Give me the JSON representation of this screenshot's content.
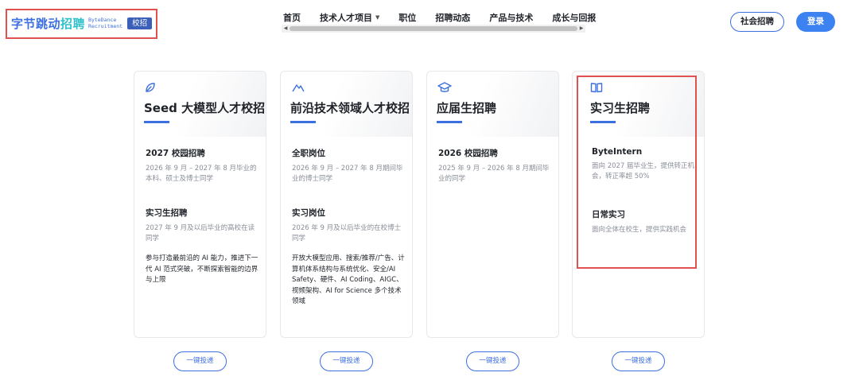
{
  "logo": {
    "cn_part1": "字节跳动",
    "cn_part2": "招聘",
    "en_line1": "ByteDance",
    "en_line2": "Recruitment",
    "badge": "校招"
  },
  "nav": {
    "items": [
      "首页",
      "技术人才项目",
      "职位",
      "招聘动态",
      "产品与技术",
      "成长与回报"
    ]
  },
  "header": {
    "social_label": "社会招聘",
    "login_label": "登录"
  },
  "colors": {
    "accent": "#3c6fe0",
    "annotation": "#e0524f"
  },
  "cards": [
    {
      "icon": "leaf-icon",
      "title": "Seed 大模型人才校招",
      "sections": [
        {
          "title": "2027 校园招聘",
          "desc": "2026 年 9 月 – 2027 年 8 月毕业的本科、硕士及博士同学"
        },
        {
          "title": "实习生招聘",
          "desc": "2027 年 9 月及以后毕业的高校在读同学"
        }
      ],
      "note": "参与打造最前沿的 AI 能力，推进下一代 AI 范式突破，不断探索智能的边界与上限"
    },
    {
      "icon": "mountain-icon",
      "title": "前沿技术领域人才校招",
      "sections": [
        {
          "title": "全职岗位",
          "desc": "2026 年 9 月 – 2027 年 8 月期间毕业的博士同学"
        },
        {
          "title": "实习岗位",
          "desc": "2026 年 9 月及以后毕业的在校博士同学"
        }
      ],
      "note": "开放大模型应用、搜索/推荐/广告、计算机体系结构与系统优化、安全/AI Safety、硬件、AI Coding、AIGC、视频架构、AI for Science 多个技术领域"
    },
    {
      "icon": "graduation-cap-icon",
      "title": "应届生招聘",
      "sections": [
        {
          "title": "2026 校园招聘",
          "desc": "2025 年 9 月 – 2026 年 8 月期间毕业的同学"
        }
      ],
      "note": ""
    },
    {
      "icon": "book-icon",
      "title": "实习生招聘",
      "sections": [
        {
          "title": "ByteIntern",
          "desc": "面向 2027 届毕业生，提供转正机会，转正率超 50%"
        },
        {
          "title": "日常实习",
          "desc": "面向全体在校生，提供实践机会"
        }
      ],
      "note": ""
    }
  ],
  "apply_label": "一键投递"
}
